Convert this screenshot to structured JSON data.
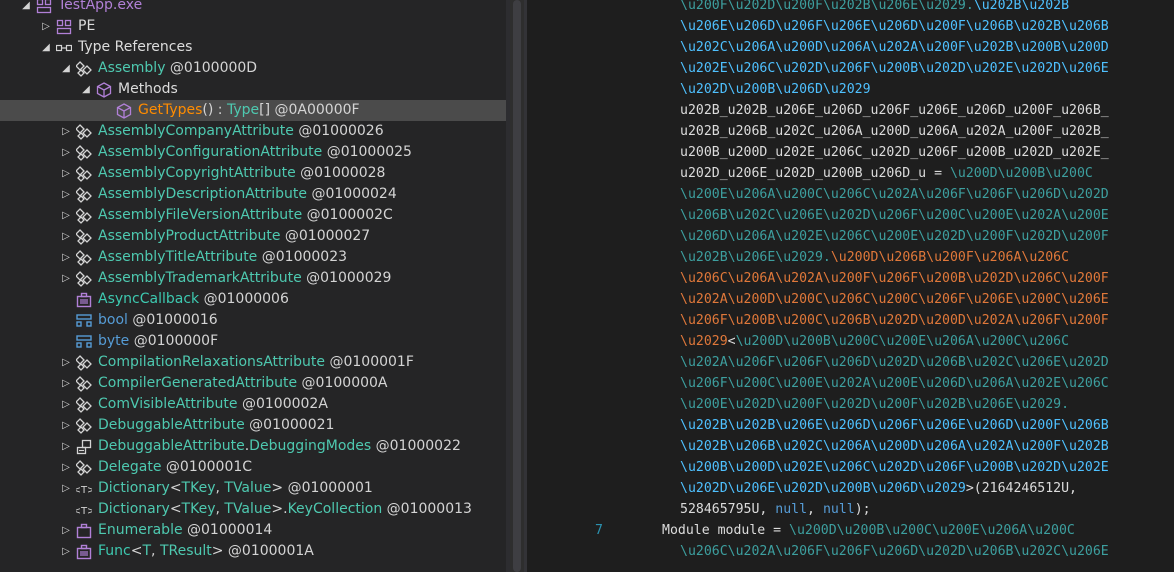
{
  "tree": {
    "rows": [
      {
        "parts": [
          {
            "t": "TestApp.exe",
            "c": "t-purple"
          }
        ],
        "icon": "assembly-icon"
      },
      {
        "parts": [
          {
            "t": "PE",
            "c": "t-white"
          }
        ],
        "icon": "module-icon"
      },
      {
        "parts": [
          {
            "t": "Type References",
            "c": "t-white"
          }
        ],
        "icon": "type-references-icon"
      },
      {
        "parts": [
          {
            "t": "Assembly",
            "c": "t-green"
          },
          {
            "t": " @0100000D",
            "c": "t-num"
          }
        ],
        "icon": "class-icon"
      },
      {
        "parts": [
          {
            "t": "Methods",
            "c": "t-white"
          }
        ],
        "icon": "methods-icon"
      },
      {
        "parts": [
          {
            "t": "GetTypes",
            "c": "t-orange"
          },
          {
            "t": "() : ",
            "c": "t-lgray"
          },
          {
            "t": "Type",
            "c": "t-green"
          },
          {
            "t": "[] @0A00000F",
            "c": "t-num"
          }
        ],
        "icon": "method-icon"
      },
      {
        "parts": [
          {
            "t": "AssemblyCompanyAttribute",
            "c": "t-green"
          },
          {
            "t": " @01000026",
            "c": "t-num"
          }
        ],
        "icon": "class-icon"
      },
      {
        "parts": [
          {
            "t": "AssemblyConfigurationAttribute",
            "c": "t-green"
          },
          {
            "t": " @01000025",
            "c": "t-num"
          }
        ],
        "icon": "class-icon"
      },
      {
        "parts": [
          {
            "t": "AssemblyCopyrightAttribute",
            "c": "t-green"
          },
          {
            "t": " @01000028",
            "c": "t-num"
          }
        ],
        "icon": "class-icon"
      },
      {
        "parts": [
          {
            "t": "AssemblyDescriptionAttribute",
            "c": "t-green"
          },
          {
            "t": " @01000024",
            "c": "t-num"
          }
        ],
        "icon": "class-icon"
      },
      {
        "parts": [
          {
            "t": "AssemblyFileVersionAttribute",
            "c": "t-green"
          },
          {
            "t": " @0100002C",
            "c": "t-num"
          }
        ],
        "icon": "class-icon"
      },
      {
        "parts": [
          {
            "t": "AssemblyProductAttribute",
            "c": "t-green"
          },
          {
            "t": " @01000027",
            "c": "t-num"
          }
        ],
        "icon": "class-icon"
      },
      {
        "parts": [
          {
            "t": "AssemblyTitleAttribute",
            "c": "t-green"
          },
          {
            "t": " @01000023",
            "c": "t-num"
          }
        ],
        "icon": "class-icon"
      },
      {
        "parts": [
          {
            "t": "AssemblyTrademarkAttribute",
            "c": "t-green"
          },
          {
            "t": " @01000029",
            "c": "t-num"
          }
        ],
        "icon": "class-icon"
      },
      {
        "parts": [
          {
            "t": "AsyncCallback",
            "c": "t-teal"
          },
          {
            "t": " @01000006",
            "c": "t-num"
          }
        ],
        "icon": "delegate-icon"
      },
      {
        "parts": [
          {
            "t": "bool",
            "c": "t-blue"
          },
          {
            "t": " @01000016",
            "c": "t-num"
          }
        ],
        "icon": "struct-icon"
      },
      {
        "parts": [
          {
            "t": "byte",
            "c": "t-blue"
          },
          {
            "t": " @0100000F",
            "c": "t-num"
          }
        ],
        "icon": "struct-icon"
      },
      {
        "parts": [
          {
            "t": "CompilationRelaxationsAttribute",
            "c": "t-green"
          },
          {
            "t": " @0100001F",
            "c": "t-num"
          }
        ],
        "icon": "class-icon"
      },
      {
        "parts": [
          {
            "t": "CompilerGeneratedAttribute",
            "c": "t-green"
          },
          {
            "t": " @0100000A",
            "c": "t-num"
          }
        ],
        "icon": "class-icon"
      },
      {
        "parts": [
          {
            "t": "ComVisibleAttribute",
            "c": "t-green"
          },
          {
            "t": " @0100002A",
            "c": "t-num"
          }
        ],
        "icon": "class-icon"
      },
      {
        "parts": [
          {
            "t": "DebuggableAttribute",
            "c": "t-green"
          },
          {
            "t": " @01000021",
            "c": "t-num"
          }
        ],
        "icon": "class-icon"
      },
      {
        "parts": [
          {
            "t": "DebuggableAttribute",
            "c": "t-green"
          },
          {
            "t": ".",
            "c": "t-lgray"
          },
          {
            "t": "DebuggingModes",
            "c": "t-green"
          },
          {
            "t": " @01000022",
            "c": "t-num"
          }
        ],
        "icon": "enum-icon"
      },
      {
        "parts": [
          {
            "t": "Delegate",
            "c": "t-green"
          },
          {
            "t": " @0100001C",
            "c": "t-num"
          }
        ],
        "icon": "class-icon"
      },
      {
        "parts": [
          {
            "t": "Dictionary",
            "c": "t-green"
          },
          {
            "t": "<",
            "c": "t-lgray"
          },
          {
            "t": "TKey",
            "c": "t-gen"
          },
          {
            "t": ", ",
            "c": "t-lgray"
          },
          {
            "t": "TValue",
            "c": "t-gen"
          },
          {
            "t": "> @01000001",
            "c": "t-num"
          }
        ],
        "icon": "generic-type-icon",
        "icontext": "<T>"
      },
      {
        "parts": [
          {
            "t": "Dictionary",
            "c": "t-green"
          },
          {
            "t": "<",
            "c": "t-lgray"
          },
          {
            "t": "TKey",
            "c": "t-gen"
          },
          {
            "t": ", ",
            "c": "t-lgray"
          },
          {
            "t": "TValue",
            "c": "t-gen"
          },
          {
            "t": ">.",
            "c": "t-lgray"
          },
          {
            "t": "KeyCollection",
            "c": "t-green"
          },
          {
            "t": " @01000013",
            "c": "t-num"
          }
        ],
        "icon": "generic-type-icon",
        "icontext": "<T>"
      },
      {
        "parts": [
          {
            "t": "Enumerable",
            "c": "t-green"
          },
          {
            "t": " @01000014",
            "c": "t-num"
          }
        ],
        "icon": "static-class-icon"
      },
      {
        "parts": [
          {
            "t": "Func",
            "c": "t-teal"
          },
          {
            "t": "<",
            "c": "t-lgray"
          },
          {
            "t": "T",
            "c": "t-gen"
          },
          {
            "t": ", ",
            "c": "t-lgray"
          },
          {
            "t": "TResult",
            "c": "t-gen"
          },
          {
            "t": "> @0100001A",
            "c": "t-num"
          }
        ],
        "icon": "delegate-icon"
      }
    ]
  },
  "code": {
    "lines": [
      {
        "ln": "",
        "segs": [
          {
            "t": "\\u200F\\u202D\\u200F\\u202B\\u206E\\u2029.",
            "c": "c2"
          },
          {
            "t": "\\u202B\\u202B",
            "c": "c1"
          }
        ]
      },
      {
        "ln": "",
        "segs": [
          {
            "t": "\\u206E\\u206D\\u206F\\u206E\\u206D\\u200F\\u206B\\u202B\\u206B",
            "c": "c1"
          }
        ]
      },
      {
        "ln": "",
        "segs": [
          {
            "t": "\\u202C\\u206A\\u200D\\u206A\\u202A\\u200F\\u202B\\u200B\\u200D",
            "c": "c1"
          }
        ]
      },
      {
        "ln": "",
        "segs": [
          {
            "t": "\\u202E\\u206C\\u202D\\u206F\\u200B\\u202D\\u202E\\u202D\\u206E",
            "c": "c1"
          }
        ]
      },
      {
        "ln": "",
        "segs": [
          {
            "t": "\\u202D\\u200B\\u206D\\u2029",
            "c": "c1"
          }
        ]
      },
      {
        "ln": "",
        "segs": [
          {
            "t": "u202B_u202B_u206E_u206D_u206F_u206E_u206D_u200F_u206B_",
            "c": "c4"
          }
        ]
      },
      {
        "ln": "",
        "segs": [
          {
            "t": "u202B_u206B_u202C_u206A_u200D_u206A_u202A_u200F_u202B_",
            "c": "c4"
          }
        ]
      },
      {
        "ln": "",
        "segs": [
          {
            "t": "u200B_u200D_u202E_u206C_u202D_u206F_u200B_u202D_u202E_",
            "c": "c4"
          }
        ]
      },
      {
        "ln": "",
        "segs": [
          {
            "t": "u202D_u206E_u202D_u200B_u206D_u = ",
            "c": "c4"
          },
          {
            "t": "\\u200D\\u200B\\u200C",
            "c": "c2"
          }
        ]
      },
      {
        "ln": "",
        "segs": [
          {
            "t": "\\u200E\\u206A\\u200C\\u206C\\u202A\\u206F\\u206F\\u206D\\u202D",
            "c": "c2"
          }
        ]
      },
      {
        "ln": "",
        "segs": [
          {
            "t": "\\u206B\\u202C\\u206E\\u202D\\u206F\\u200C\\u200E\\u202A\\u200E",
            "c": "c2"
          }
        ]
      },
      {
        "ln": "",
        "segs": [
          {
            "t": "\\u206D\\u206A\\u202E\\u206C\\u200E\\u202D\\u200F\\u202D\\u200F",
            "c": "c2"
          }
        ]
      },
      {
        "ln": "",
        "segs": [
          {
            "t": "\\u202B\\u206E\\u2029.",
            "c": "c2"
          },
          {
            "t": "\\u200D\\u206B\\u200F\\u206A\\u206C",
            "c": "c3"
          }
        ]
      },
      {
        "ln": "",
        "segs": [
          {
            "t": "\\u206C\\u206A\\u202A\\u200F\\u206F\\u200B\\u202D\\u206C\\u200F",
            "c": "c3"
          }
        ]
      },
      {
        "ln": "",
        "segs": [
          {
            "t": "\\u202A\\u200D\\u200C\\u206C\\u200C\\u206F\\u206E\\u200C\\u206E",
            "c": "c3"
          }
        ]
      },
      {
        "ln": "",
        "segs": [
          {
            "t": "\\u206F\\u200B\\u200C\\u206B\\u202D\\u200D\\u202A\\u206F\\u200F",
            "c": "c3"
          }
        ]
      },
      {
        "ln": "",
        "segs": [
          {
            "t": "\\u2029",
            "c": "c3"
          },
          {
            "t": "<",
            "c": "c4"
          },
          {
            "t": "\\u200D\\u200B\\u200C\\u200E\\u206A\\u200C\\u206C",
            "c": "c2"
          }
        ]
      },
      {
        "ln": "",
        "segs": [
          {
            "t": "\\u202A\\u206F\\u206F\\u206D\\u202D\\u206B\\u202C\\u206E\\u202D",
            "c": "c2"
          }
        ]
      },
      {
        "ln": "",
        "segs": [
          {
            "t": "\\u206F\\u200C\\u200E\\u202A\\u200E\\u206D\\u206A\\u202E\\u206C",
            "c": "c2"
          }
        ]
      },
      {
        "ln": "",
        "segs": [
          {
            "t": "\\u200E\\u202D\\u200F\\u202D\\u200F\\u202B\\u206E\\u2029.",
            "c": "c2"
          }
        ]
      },
      {
        "ln": "",
        "segs": [
          {
            "t": "\\u202B\\u202B\\u206E\\u206D\\u206F\\u206E\\u206D\\u200F\\u206B",
            "c": "c1"
          }
        ]
      },
      {
        "ln": "",
        "segs": [
          {
            "t": "\\u202B\\u206B\\u202C\\u206A\\u200D\\u206A\\u202A\\u200F\\u202B",
            "c": "c1"
          }
        ]
      },
      {
        "ln": "",
        "segs": [
          {
            "t": "\\u200B\\u200D\\u202E\\u206C\\u202D\\u206F\\u200B\\u202D\\u202E",
            "c": "c1"
          }
        ]
      },
      {
        "ln": "",
        "segs": [
          {
            "t": "\\u202D\\u206E\\u202D\\u200B\\u206D\\u2029",
            "c": "c1"
          },
          {
            "t": ">(2164246512U,",
            "c": "c4"
          }
        ]
      },
      {
        "ln": "",
        "segs": [
          {
            "t": "528465795U, ",
            "c": "c4"
          },
          {
            "t": "null",
            "c": "ckw"
          },
          {
            "t": ", ",
            "c": "c4"
          },
          {
            "t": "null",
            "c": "ckw"
          },
          {
            "t": ");",
            "c": "c4"
          }
        ]
      },
      {
        "ln": "7",
        "segs": [
          {
            "t": "Module",
            "c": "c4"
          },
          {
            "t": " module = ",
            "c": "c4"
          },
          {
            "t": "\\u200D\\u200B\\u200C\\u200E\\u206A\\u200C",
            "c": "c2"
          }
        ]
      },
      {
        "ln": "",
        "segs": [
          {
            "t": "\\u206C\\u202A\\u206F\\u206F\\u206D\\u202D\\u206B\\u202C\\u206E",
            "c": "c2"
          }
        ]
      }
    ]
  },
  "colors": {
    "tree_bg": "#252526",
    "selection": "#4b4b4b",
    "type_green": "#4ec9b0",
    "method_orange": "#ff8c00",
    "keyword_blue": "#569cd6",
    "icon_purple": "#b180d7"
  }
}
